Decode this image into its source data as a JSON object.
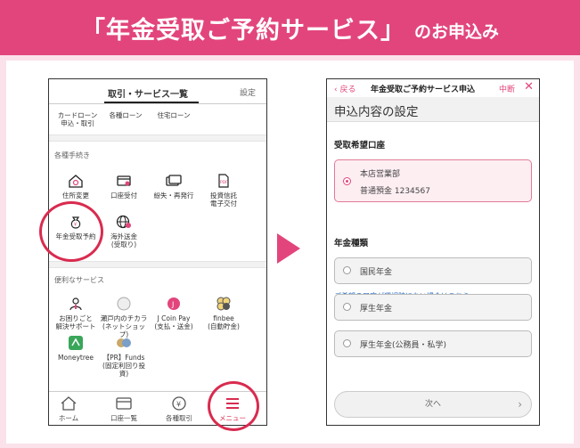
{
  "banner": {
    "title": "「年金受取ご予約サービス」",
    "subtitle": "のお申込み"
  },
  "left_screen": {
    "tab_active": "取引・サービス一覧",
    "tab_settings": "設定",
    "loans": [
      "カードローン\n申込・取引",
      "各種ローン",
      "住宅ローン"
    ],
    "section_procedures": "各種手続き",
    "procedures": [
      "住所変更",
      "口座受付",
      "紛失・再発行",
      "投資信託\n電子交付",
      "年金受取予約",
      "海外送金\n(受取り)"
    ],
    "section_services": "便利なサービス",
    "services": [
      "お困りごと\n解決サポート",
      "瀬戸内のチカラ\n(ネットショップ)",
      "J Coin Pay\n(支払・送金)",
      "finbee\n(自動貯金)",
      "Moneytree",
      "【PR】Funds\n(固定利回り投資)"
    ],
    "bottom_nav": [
      "ホーム",
      "口座一覧",
      "各種取引",
      "メニュー"
    ]
  },
  "right_screen": {
    "back": "戻る",
    "header_title": "年金受取ご予約サービス申込",
    "interrupt": "中断",
    "close": "✕",
    "page_title": "申込内容の設定",
    "account_label": "受取希望口座",
    "account_line1": "本店営業部",
    "account_line2": "普通預金 1234567",
    "link_text": "ご希望の口座が選択肢にない場合はこちら",
    "pension_label": "年金種類",
    "options": [
      "国民年金",
      "厚生年金",
      "厚生年金(公務員・私学)"
    ],
    "next_label": "次へ"
  },
  "colors": {
    "brand": "#e2457c",
    "highlight": "#d92b4f",
    "background": "#fbe2ea"
  }
}
